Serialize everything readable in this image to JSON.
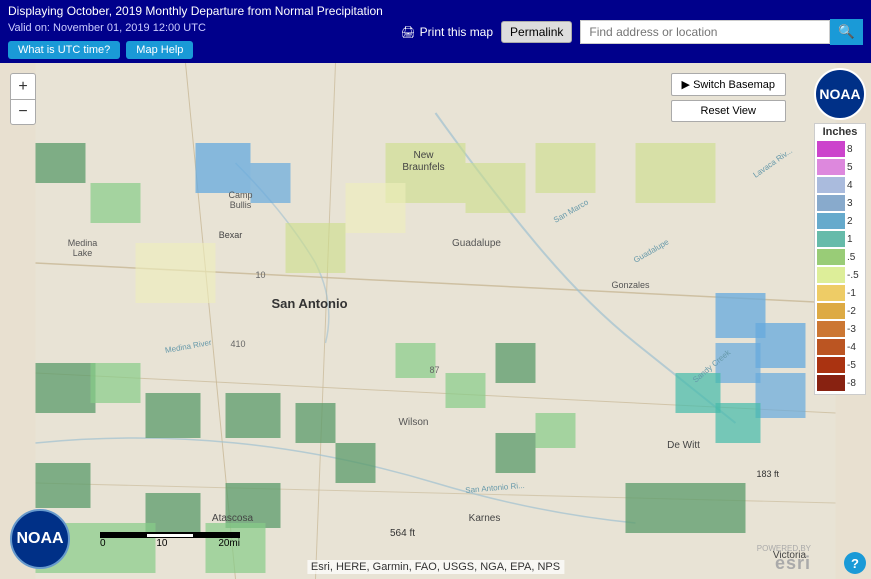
{
  "header": {
    "title": "Displaying October, 2019 Monthly Departure from Normal Precipitation",
    "valid": "Valid on: November 01, 2019 12:00 UTC",
    "utc_btn": "What is UTC time?",
    "help_btn": "Map Help",
    "print_btn": "Print this map",
    "permalink_btn": "Permalink",
    "search_placeholder": "Find address or location"
  },
  "map": {
    "zoom_in": "+",
    "zoom_out": "−",
    "switch_basemap": "▶ Switch Basemap",
    "reset_view": "Reset View",
    "scale_ft": "564 ft",
    "scale_ft2": "183 ft",
    "attribution": "Esri, HERE, Garmin, FAO, USGS, NGA, EPA, NPS",
    "powered_by": "POWERED BY",
    "esri": "esri",
    "help": "?",
    "scale_labels": [
      "0",
      "10",
      "20mi"
    ],
    "noaa_text": "NOAA",
    "inches_label": "Inches"
  },
  "legend": {
    "title": "Inches",
    "items": [
      {
        "value": "8",
        "color": "#cc00cc"
      },
      {
        "value": "5",
        "color": "#cc66cc"
      },
      {
        "value": "4",
        "color": "#9966cc"
      },
      {
        "value": "3",
        "color": "#6699cc"
      },
      {
        "value": "2",
        "color": "#66cccc"
      },
      {
        "value": "1",
        "color": "#66cc99"
      },
      {
        "value": ".5",
        "color": "#99dd66"
      },
      {
        "value": ".5",
        "color": "#ccee99"
      },
      {
        "value": "-1",
        "color": "#eeee99"
      },
      {
        "value": "-2",
        "color": "#eecc66"
      },
      {
        "value": "-3",
        "color": "#dd9944"
      },
      {
        "value": "-4",
        "color": "#cc6633"
      },
      {
        "value": "-5",
        "color": "#bb4422"
      },
      {
        "value": "-8",
        "color": "#882211"
      }
    ]
  }
}
